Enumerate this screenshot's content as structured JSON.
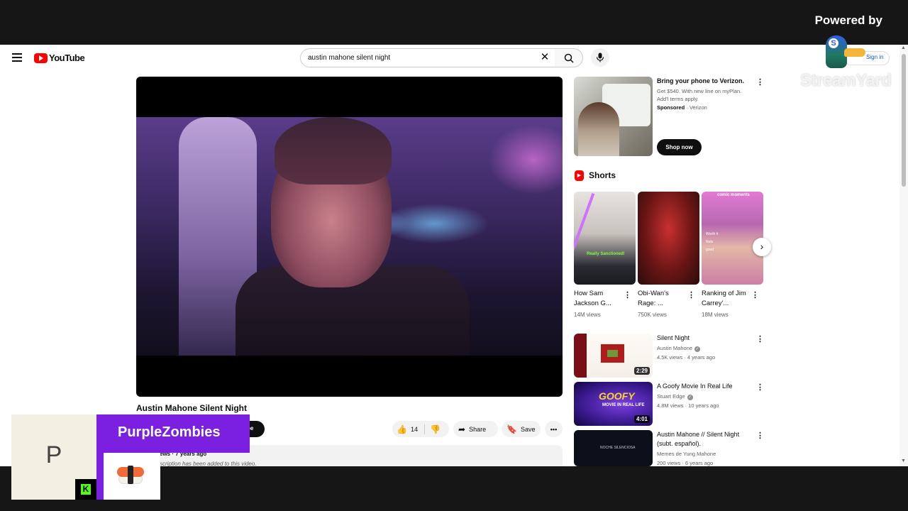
{
  "overlay": {
    "powered_by": "Powered by",
    "brand": "StreamYard",
    "brand_initial": "S",
    "camera_initial": "P",
    "display_name": "PurpleZombies",
    "platform_badge": "K"
  },
  "header": {
    "logo_text": "YouTube",
    "search_value": "austin mahone silent night",
    "clear_icon": "✕",
    "sign_in": "Sign in"
  },
  "video": {
    "title": "Austin Mahone Silent Night",
    "subscribe": "be",
    "likes": "14",
    "share": "Share",
    "save": "Save",
    "more": "•••",
    "desc_line1": "ews · 7 years ago",
    "desc_line2": "scription has been added to this video."
  },
  "ad": {
    "title": "Bring your phone to Verizon.",
    "desc": "Get $540. With new line on myPlan. Add'l terms apply.",
    "sponsored": "Sponsored",
    "advertiser": " · Verizon",
    "cta": "Shop now"
  },
  "shorts": {
    "heading": "Shorts",
    "items": [
      {
        "title": "How Sam Jackson G...",
        "views": "14M views",
        "overlay": "Really Sanctioned!"
      },
      {
        "title": "Obi-Wan's Rage: ...",
        "views": "750K views"
      },
      {
        "title": "Ranking of Jim Carrey'...",
        "views": "18M views",
        "overlay": "comic moments",
        "list": "Worth it\nNuts\ngood"
      }
    ]
  },
  "recommendations": [
    {
      "title": "Silent Night",
      "channel": "Austin Mahone",
      "meta": "4.5K views · 4 years ago",
      "duration": "2:29"
    },
    {
      "title": "A Goofy Movie In Real Life",
      "channel": "Stuart Edge",
      "meta": "4.8M views · 10 years ago",
      "duration": "4:01",
      "thumb_text": "GOOFY",
      "thumb_sub": "MOVIE IN REAL LIFE"
    },
    {
      "title": "Austin Mahone // Silent Night (subt. español).",
      "channel": "Memes de Yung Mahone",
      "meta": "200 views · 6 years ago",
      "thumb_text": "NOCHE SILENCIOSA"
    }
  ],
  "colors": {
    "brand_red": "#ff0000",
    "overlay_purple": "#7b1fe0",
    "kick_green": "#53fc18"
  }
}
